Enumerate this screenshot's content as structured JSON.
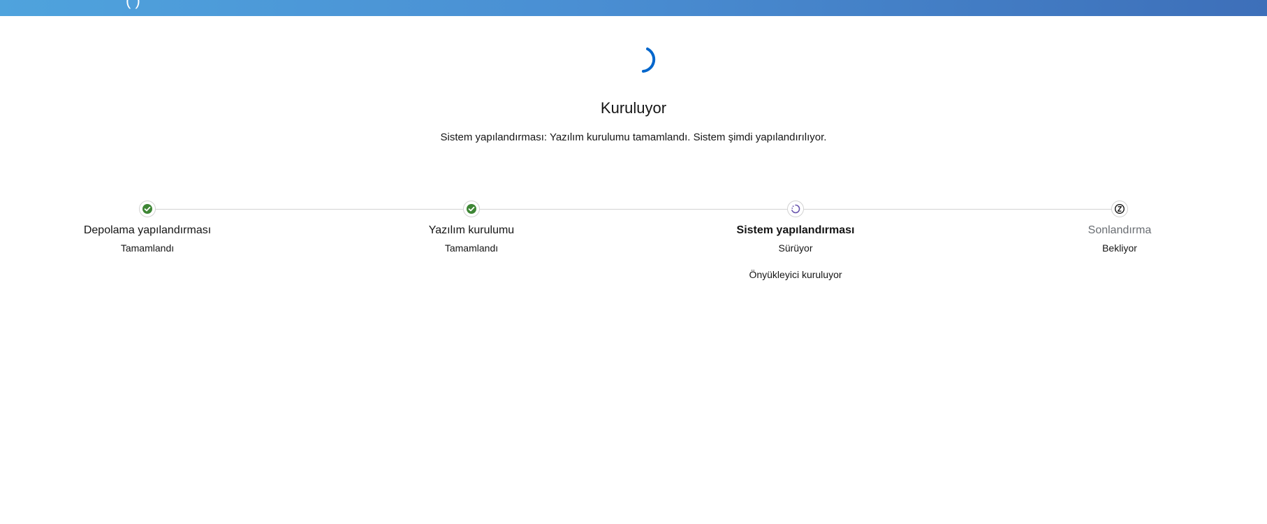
{
  "header": {
    "title": "(                              )"
  },
  "main": {
    "title": "Kuruluyor",
    "subtitle": "Sistem yapılandırması: Yazılım kurulumu tamamlandı. Sistem şimdi yapılandırılıyor."
  },
  "steps": [
    {
      "label": "Depolama yapılandırması",
      "status": "Tamamlandı",
      "state": "done",
      "icon": "check-circle-icon"
    },
    {
      "label": "Yazılım kurulumu",
      "status": "Tamamlandı",
      "state": "done",
      "icon": "check-circle-icon"
    },
    {
      "label": "Sistem yapılandırması",
      "status": "Sürüyor",
      "state": "current",
      "icon": "in-progress-icon",
      "detail": "Önyükleyici kuruluyor"
    },
    {
      "label": "Sonlandırma",
      "status": "Bekliyor",
      "state": "pending",
      "icon": "pending-icon"
    }
  ],
  "colors": {
    "header_gradient_start": "#4fa3dd",
    "header_gradient_end": "#3d6fb9",
    "spinner": "#0066cc",
    "success": "#3e8635",
    "in_progress": "#6753ac",
    "pending": "#151515"
  }
}
